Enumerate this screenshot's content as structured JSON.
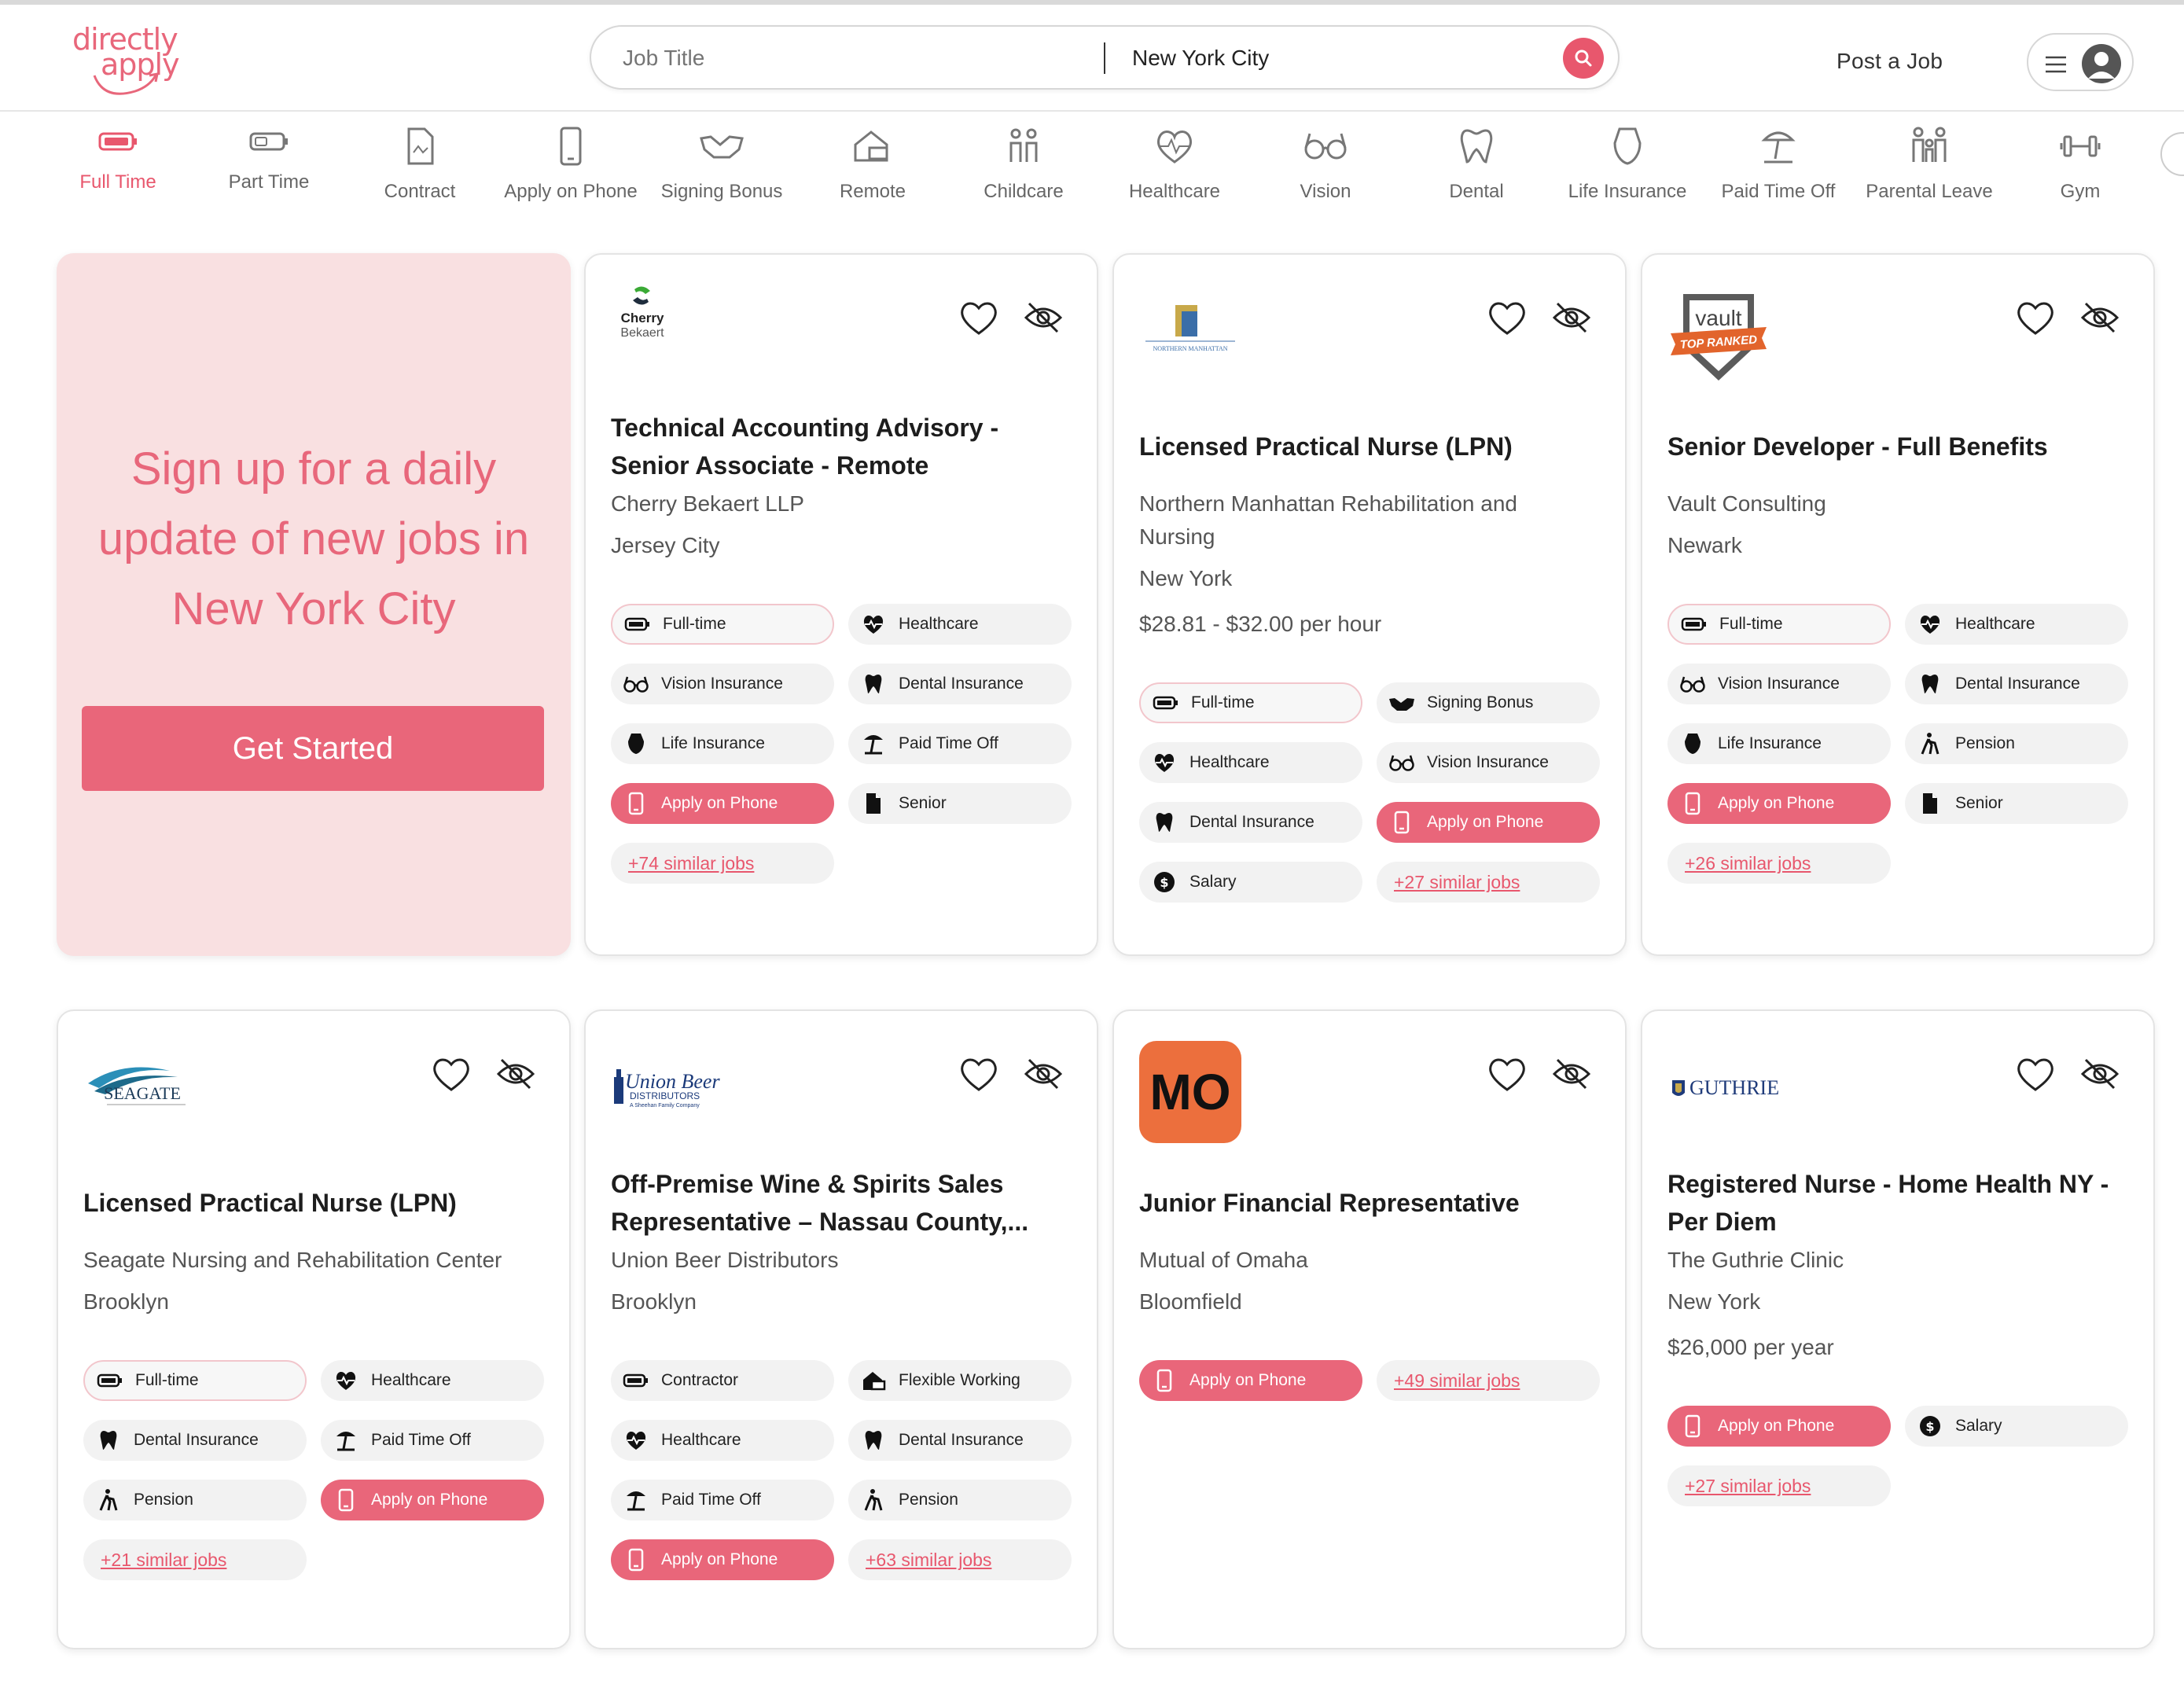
{
  "brand": {
    "line1": "directly",
    "line2": "apply",
    "color": "#e8677b"
  },
  "search": {
    "title_placeholder": "Job Title",
    "location_value": "New York City"
  },
  "header": {
    "post_job": "Post a Job"
  },
  "categories": [
    {
      "label": "Full Time",
      "icon": "battery-full-icon",
      "active": true
    },
    {
      "label": "Part Time",
      "icon": "battery-half-icon"
    },
    {
      "label": "Contract",
      "icon": "document-icon"
    },
    {
      "label": "Apply on Phone",
      "icon": "phone-icon"
    },
    {
      "label": "Signing Bonus",
      "icon": "handshake-icon"
    },
    {
      "label": "Remote",
      "icon": "home-laptop-icon"
    },
    {
      "label": "Childcare",
      "icon": "children-icon"
    },
    {
      "label": "Healthcare",
      "icon": "heart-pulse-icon"
    },
    {
      "label": "Vision",
      "icon": "glasses-icon"
    },
    {
      "label": "Dental",
      "icon": "tooth-icon"
    },
    {
      "label": "Life Insurance",
      "icon": "shield-icon"
    },
    {
      "label": "Paid Time Off",
      "icon": "beach-umbrella-icon"
    },
    {
      "label": "Parental Leave",
      "icon": "family-icon"
    },
    {
      "label": "Gym",
      "icon": "dumbbell-icon"
    }
  ],
  "promo": {
    "line1": "Sign up for a daily",
    "line2": "update of new jobs in",
    "line3": "New York City",
    "button": "Get Started"
  },
  "jobs": [
    {
      "logo_text": [
        "Cherry",
        "Bekaert"
      ],
      "title": [
        "Technical Accounting Advisory -",
        "Senior Associate - Remote"
      ],
      "company": [
        "Cherry Bekaert LLP"
      ],
      "location": "Jersey City",
      "tags": [
        "Full-time",
        "Healthcare",
        "Vision Insurance",
        "Dental Insurance",
        "Life Insurance",
        "Paid Time Off",
        "Apply on Phone",
        "Senior"
      ],
      "similar": "+74 similar jobs"
    },
    {
      "logo_text": [
        "NORTHERN MANHATTAN"
      ],
      "title": [
        "Licensed Practical Nurse (LPN)"
      ],
      "company": [
        "Northern Manhattan Rehabilitation and",
        "Nursing"
      ],
      "location": "New York",
      "pay": "$28.81 - $32.00 per hour",
      "tags": [
        "Full-time",
        "Signing Bonus",
        "Healthcare",
        "Vision Insurance",
        "Dental Insurance",
        "Apply on Phone",
        "Salary"
      ],
      "similar": "+27 similar jobs"
    },
    {
      "logo_text": [
        "vault",
        "TOP RANKED"
      ],
      "title": [
        "Senior Developer - Full Benefits"
      ],
      "company": [
        "Vault Consulting"
      ],
      "location": "Newark",
      "tags": [
        "Full-time",
        "Healthcare",
        "Vision Insurance",
        "Dental Insurance",
        "Life Insurance",
        "Pension",
        "Apply on Phone",
        "Senior"
      ],
      "similar": "+26 similar jobs"
    },
    {
      "logo_text": [
        "SEAGATE"
      ],
      "title": [
        "Licensed Practical Nurse (LPN)"
      ],
      "company": [
        "Seagate Nursing and Rehabilitation Center"
      ],
      "location": "Brooklyn",
      "tags": [
        "Full-time",
        "Healthcare",
        "Dental Insurance",
        "Paid Time Off",
        "Pension",
        "Apply on Phone"
      ],
      "similar": "+21 similar jobs"
    },
    {
      "logo_text": [
        "Union Beer",
        "DISTRIBUTORS"
      ],
      "title": [
        "Off-Premise Wine & Spirits Sales",
        "Representative – Nassau County,..."
      ],
      "company": [
        "Union Beer Distributors"
      ],
      "location": "Brooklyn",
      "tags": [
        "Contractor",
        "Flexible Working",
        "Healthcare",
        "Dental Insurance",
        "Paid Time Off",
        "Pension",
        "Apply on Phone"
      ],
      "similar": "+63 similar jobs"
    },
    {
      "logo_text": [
        "MO"
      ],
      "title": [
        "Junior Financial Representative"
      ],
      "company": [
        "Mutual of Omaha"
      ],
      "location": "Bloomfield",
      "tags": [
        "Apply on Phone"
      ],
      "similar": "+49 similar jobs"
    },
    {
      "logo_text": [
        "GUTHRIE"
      ],
      "title": [
        "Registered Nurse - Home Health NY -",
        "Per Diem"
      ],
      "company": [
        "The Guthrie Clinic"
      ],
      "location": "New York",
      "pay": "$26,000 per year",
      "tags": [
        "Apply on Phone",
        "Salary"
      ],
      "similar": "+27 similar jobs"
    }
  ],
  "colors": {
    "accent": "#e8576d",
    "promo_bg": "#f9e0e1",
    "tag_bg": "#f2f2f2",
    "mo_logo": "#ec6f3d"
  }
}
